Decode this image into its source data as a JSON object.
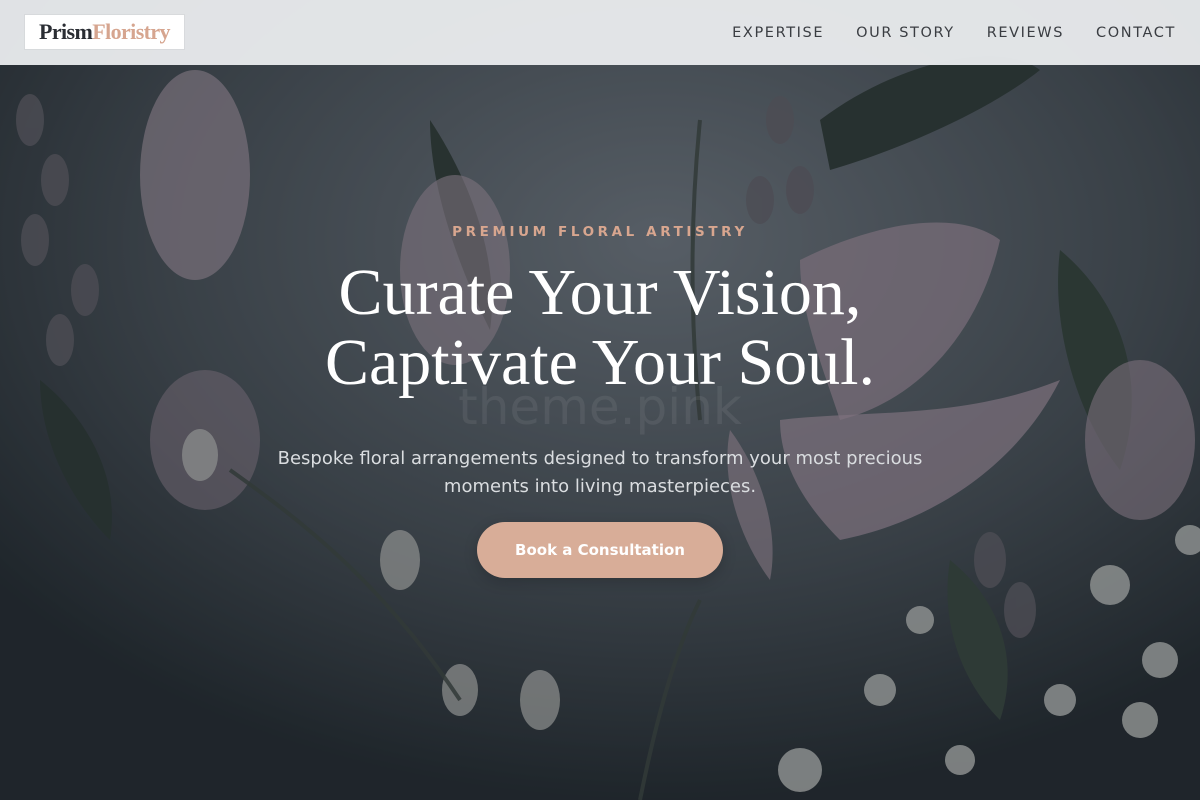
{
  "brand": {
    "name_part1": "Prism",
    "name_part2": "Floristry"
  },
  "nav": {
    "items": [
      {
        "label": "EXPERTISE"
      },
      {
        "label": "OUR STORY"
      },
      {
        "label": "REVIEWS"
      },
      {
        "label": "CONTACT"
      }
    ]
  },
  "hero": {
    "eyebrow": "PREMIUM FLORAL ARTISTRY",
    "title_line1": "Curate Your Vision,",
    "title_line2": "Captivate Your Soul.",
    "subtitle": "Bespoke floral arrangements designed to transform your most precious moments into living masterpieces.",
    "cta_label": "Book a Consultation",
    "watermark": "theme.pink"
  },
  "colors": {
    "accent": "#d8ad98",
    "eyebrow": "#d8a68f",
    "header_bg": "#eceef0",
    "text_dark": "#3a3d42"
  }
}
